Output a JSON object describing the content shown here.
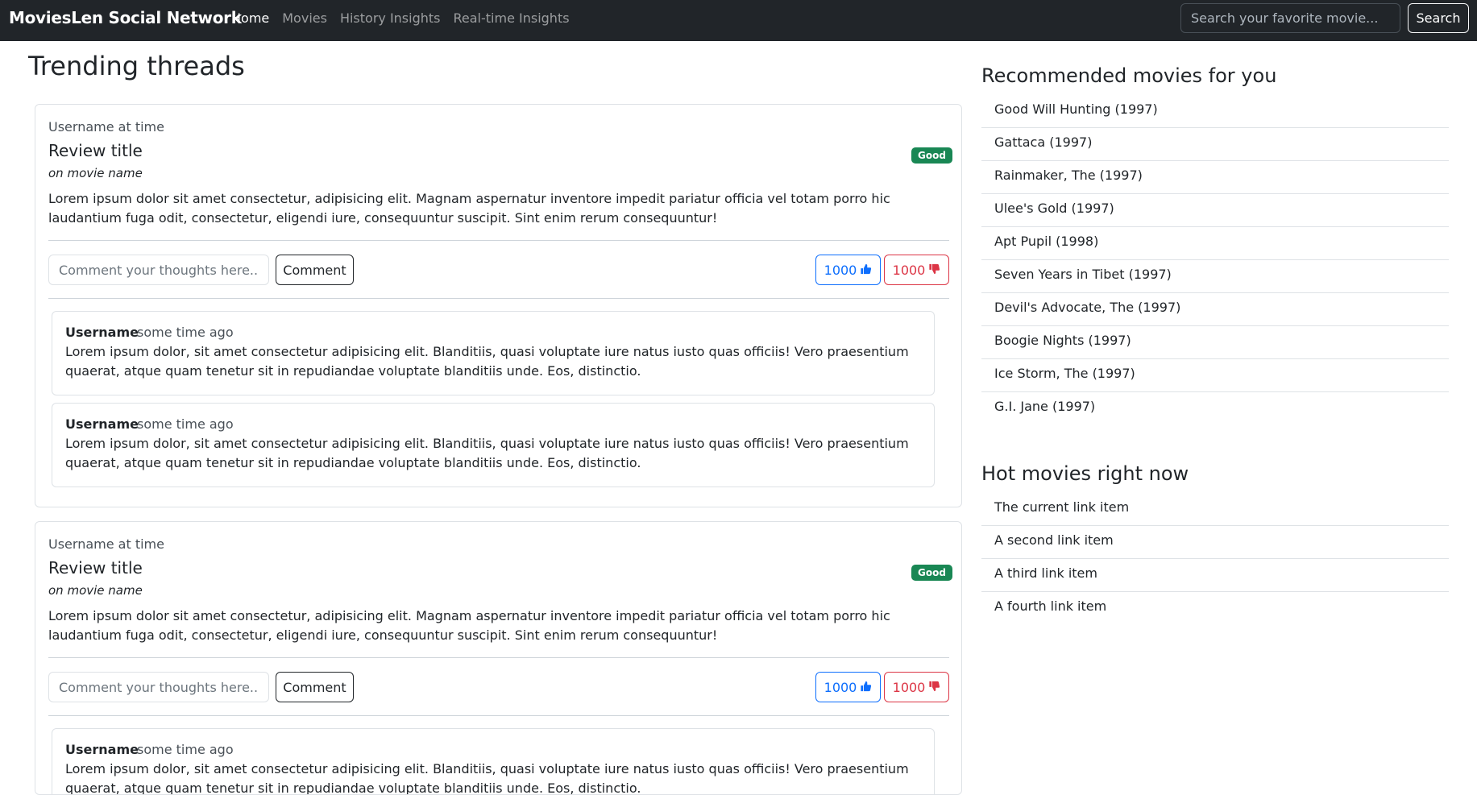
{
  "nav": {
    "brand": "MoviesLen Social Network",
    "links": [
      "Home",
      "Movies",
      "History Insights",
      "Real-time Insights"
    ],
    "search_placeholder": "Search your favorite movie...",
    "search_label": "Search"
  },
  "main": {
    "title": "Trending threads",
    "threads": [
      {
        "meta": "Username at time",
        "title": "Review title",
        "movie": "on movie name",
        "badge": "Good",
        "body": "Lorem ipsum dolor sit amet consectetur, adipisicing elit. Magnam aspernatur inventore impedit pariatur officia vel totam porro hic laudantium fuga odit, consectetur, eligendi iure, consequuntur suscipit. Sint enim rerum consequuntur!",
        "comment_placeholder": "Comment your thoughts here...",
        "comment_label": "Comment",
        "likes": "1000",
        "dislikes": "1000",
        "comments": [
          {
            "user": "Username",
            "time": "some time ago",
            "text": "Lorem ipsum dolor, sit amet consectetur adipisicing elit. Blanditiis, quasi voluptate iure natus iusto quas officiis! Vero praesentium quaerat, atque quam tenetur sit in repudiandae voluptate blanditiis unde. Eos, distinctio."
          },
          {
            "user": "Username",
            "time": "some time ago",
            "text": "Lorem ipsum dolor, sit amet consectetur adipisicing elit. Blanditiis, quasi voluptate iure natus iusto quas officiis! Vero praesentium quaerat, atque quam tenetur sit in repudiandae voluptate blanditiis unde. Eos, distinctio."
          }
        ]
      },
      {
        "meta": "Username at time",
        "title": "Review title",
        "movie": "on movie name",
        "badge": "Good",
        "body": "Lorem ipsum dolor sit amet consectetur, adipisicing elit. Magnam aspernatur inventore impedit pariatur officia vel totam porro hic laudantium fuga odit, consectetur, eligendi iure, consequuntur suscipit. Sint enim rerum consequuntur!",
        "comment_placeholder": "Comment your thoughts here...",
        "comment_label": "Comment",
        "likes": "1000",
        "dislikes": "1000",
        "comments": [
          {
            "user": "Username",
            "time": "some time ago",
            "text": "Lorem ipsum dolor, sit amet consectetur adipisicing elit. Blanditiis, quasi voluptate iure natus iusto quas officiis! Vero praesentium quaerat, atque quam tenetur sit in repudiandae voluptate blanditiis unde. Eos, distinctio."
          }
        ]
      }
    ]
  },
  "sidebar": {
    "recommended_title": "Recommended movies for you",
    "recommended": [
      "Good Will Hunting (1997)",
      "Gattaca (1997)",
      "Rainmaker, The (1997)",
      "Ulee's Gold (1997)",
      "Apt Pupil (1998)",
      "Seven Years in Tibet (1997)",
      "Devil's Advocate, The (1997)",
      "Boogie Nights (1997)",
      "Ice Storm, The (1997)",
      "G.I. Jane (1997)"
    ],
    "hot_title": "Hot movies right now",
    "hot": [
      "The current link item",
      "A second link item",
      "A third link item",
      "A fourth link item"
    ]
  },
  "colors": {
    "navbar": "#212529",
    "good_badge": "#198754",
    "like": "#0d6efd",
    "dislike": "#dc3545"
  },
  "icons": {
    "like": "thumbs-up-icon",
    "dislike": "thumbs-down-icon"
  }
}
